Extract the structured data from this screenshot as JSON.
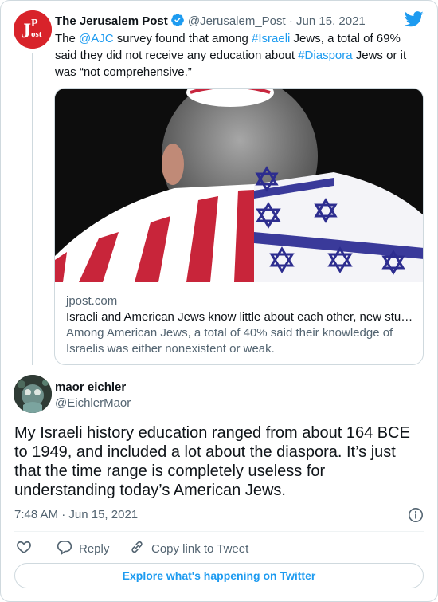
{
  "parent_tweet": {
    "author_name": "The Jerusalem Post",
    "author_handle": "@Jerusalem_Post",
    "separator": "·",
    "date": "Jun 15, 2021",
    "avatar_text": "JPost",
    "text": {
      "p1": "The ",
      "mention": "@AJC",
      "p2": " survey found that among ",
      "hashtag1": "#Israeli",
      "p3": " Jews, a total of 69% said they did not receive any education about ",
      "hashtag2": "#Diaspora",
      "p4": " Jews or it was “not comprehensive.”"
    },
    "card": {
      "domain": "jpost.com",
      "title": "Israeli and American Jews know little about each other, new stu…",
      "description": "Among American Jews, a total of 40% said their knowledge of Israelis was either nonexistent or weak."
    }
  },
  "main_tweet": {
    "author_name": "maor eichler",
    "author_handle": "@EichlerMaor",
    "text": "My Israeli history education ranged from about 164 BCE to 1949, and included a lot about the diaspora. It’s just that the time range is completely useless for understanding today’s American Jews.",
    "time": "7:48 AM",
    "separator": "·",
    "date": "Jun 15, 2021"
  },
  "actions": {
    "reply_label": "Reply",
    "copy_link_label": "Copy link to Tweet"
  },
  "footer": {
    "explore_label": "Explore what's happening on Twitter"
  },
  "icons": {
    "verified": "verified-badge-icon",
    "twitter": "twitter-bird-icon",
    "info": "info-icon",
    "like": "heart-icon",
    "reply": "speech-bubble-icon",
    "copy_link": "link-icon"
  },
  "colors": {
    "accent": "#1d9bf0",
    "brand_red": "#d8232a",
    "text": "#0f1419",
    "muted": "#536471",
    "border": "#cfd9de"
  }
}
